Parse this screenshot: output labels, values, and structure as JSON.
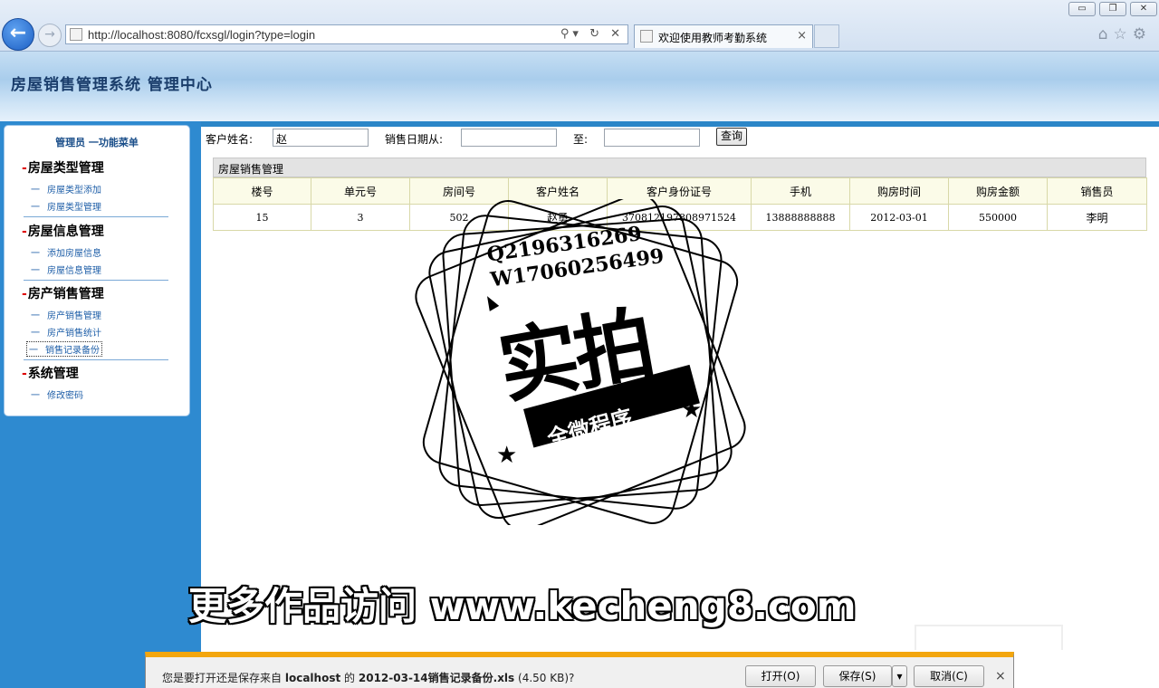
{
  "browser": {
    "url": "http://localhost:8080/fcxsgl/login?type=login",
    "tab_title": "欢迎使用教师考勤系统",
    "back_glyph": "←",
    "forward_glyph": "→",
    "tab_close": "×",
    "address_tools": "⚲▾ ↻ ✕",
    "win_min": "▭",
    "win_max": "❐",
    "win_close": "✕",
    "right_icons": "⌂☆⚙"
  },
  "header": {
    "title": "房屋销售管理系统  管理中心"
  },
  "menu": {
    "heading": "管理员  一功能菜单",
    "groups": [
      {
        "label": "房屋类型管理",
        "items": [
          "房屋类型添加",
          "房屋类型管理"
        ]
      },
      {
        "label": "房屋信息管理",
        "items": [
          "添加房屋信息",
          "房屋信息管理"
        ]
      },
      {
        "label": "房产销售管理",
        "items": [
          "房产销售管理",
          "房产销售统计",
          "销售记录备份"
        ]
      },
      {
        "label": "系统管理",
        "items": [
          "修改密码"
        ]
      }
    ],
    "selected_item": "销售记录备份"
  },
  "search": {
    "customer_label": "客户姓名:",
    "customer_value": "赵",
    "date_from_label": "销售日期从:",
    "date_from_value": "",
    "date_to_label": "至:",
    "date_to_value": "",
    "query_button": "查询"
  },
  "table": {
    "title": "房屋销售管理",
    "columns": [
      "楼号",
      "单元号",
      "房间号",
      "客户姓名",
      "客户身份证号",
      "手机",
      "购房时间",
      "购房金额",
      "销售员"
    ],
    "rows": [
      [
        "15",
        "3",
        "502",
        "赵勇",
        "370812197808971524",
        "13888888888",
        "2012-03-01",
        "550000",
        "李明"
      ]
    ]
  },
  "watermark": {
    "line1": "Q2196316269",
    "line2": "W17060256499",
    "big": "实拍",
    "banner": "全微程序",
    "caption": "更多作品访问 www.kecheng8.com"
  },
  "download_bar": {
    "message_prefix": "您是要打开还是保存来自",
    "host": "localhost",
    "message_mid": "的",
    "filename": "2012-03-14销售记录备份.xls",
    "size": "(4.50 KB)?",
    "open_button": "打开(O)",
    "save_button": "保存(S)",
    "save_dropdown": "▾",
    "cancel_button": "取消(C)",
    "close": "×"
  }
}
